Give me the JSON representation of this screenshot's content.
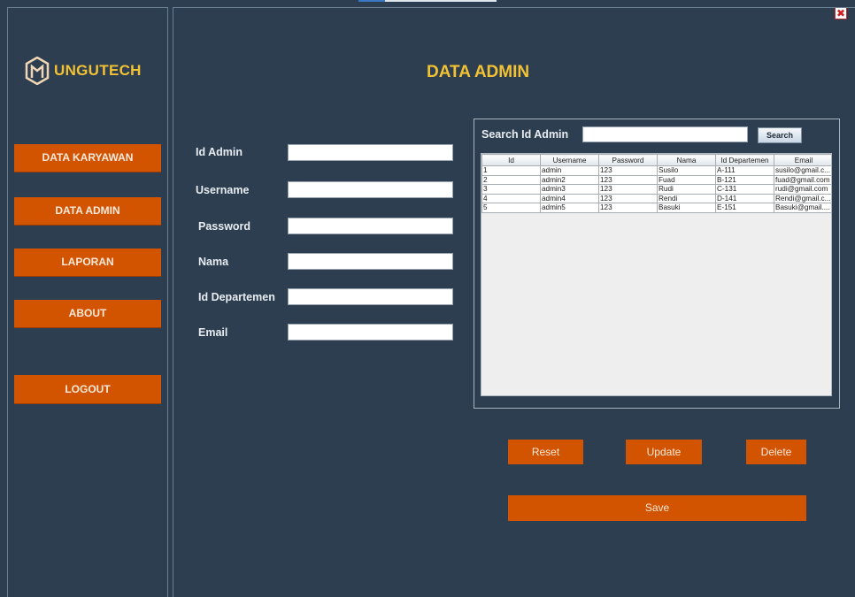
{
  "window": {
    "close_symbol": "✖"
  },
  "brand": {
    "name": "UNGUTECH",
    "logo_icon": "hexagon-m-logo"
  },
  "sidebar": {
    "items": [
      {
        "label": "DATA KARYAWAN"
      },
      {
        "label": "DATA ADMIN"
      },
      {
        "label": "LAPORAN"
      },
      {
        "label": "ABOUT"
      },
      {
        "label": "LOGOUT"
      }
    ]
  },
  "page": {
    "title": "DATA ADMIN"
  },
  "form": {
    "fields": [
      {
        "label": "Id Admin",
        "value": ""
      },
      {
        "label": "Username",
        "value": ""
      },
      {
        "label": "Password",
        "value": ""
      },
      {
        "label": "Nama",
        "value": ""
      },
      {
        "label": "Id Departemen",
        "value": ""
      },
      {
        "label": "Email",
        "value": ""
      }
    ]
  },
  "search": {
    "label": "Search Id Admin",
    "value": "",
    "button_label": "Search"
  },
  "table": {
    "columns": [
      "Id",
      "Username",
      "Password",
      "Nama",
      "Id Departemen",
      "Email"
    ],
    "rows": [
      [
        "1",
        "admin",
        "123",
        "Susilo",
        "A-111",
        "susilo@gmail.c..."
      ],
      [
        "2",
        "admin2",
        "123",
        "Fuad",
        "B-121",
        "fuad@gmail.com"
      ],
      [
        "3",
        "admin3",
        "123",
        "Rudi",
        "C-131",
        "rudi@gmail.com"
      ],
      [
        "4",
        "admin4",
        "123",
        "Rendi",
        "D-141",
        "Rendi@gmail.c..."
      ],
      [
        "5",
        "admin5",
        "123",
        "Basuki",
        "E-151",
        "Basuki@gmail...."
      ]
    ]
  },
  "actions": {
    "reset": "Reset",
    "update": "Update",
    "delete": "Delete",
    "save": "Save"
  },
  "colors": {
    "background": "#2c3e50",
    "accent": "#d35400",
    "title": "#f2c233"
  }
}
